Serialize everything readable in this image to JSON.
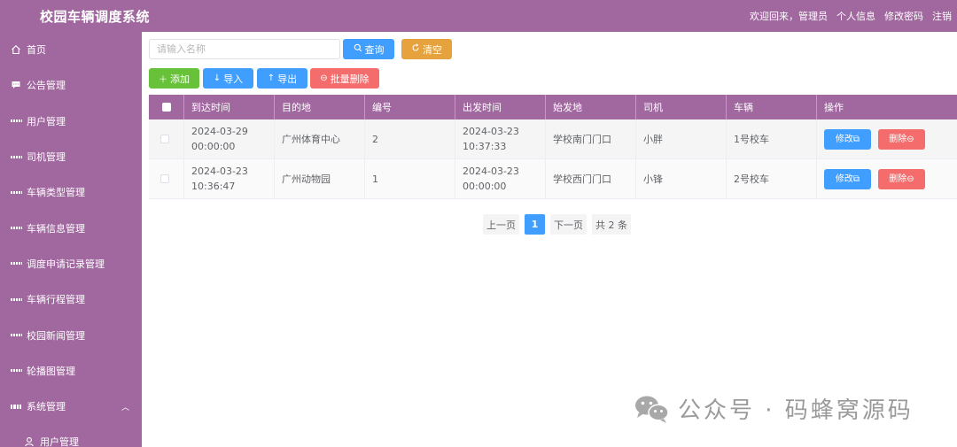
{
  "header": {
    "title": "校园车辆调度系统",
    "welcome": "欢迎回来，管理员",
    "profile": "个人信息",
    "change_password": "修改密码",
    "logout": "注销"
  },
  "sidebar": {
    "items": [
      {
        "label": "首页",
        "icon": "home-icon"
      },
      {
        "label": "公告管理",
        "icon": "chat-icon"
      },
      {
        "label": "用户管理",
        "icon": "grid-icon"
      },
      {
        "label": "司机管理",
        "icon": "grid-icon"
      },
      {
        "label": "车辆类型管理",
        "icon": "grid-icon"
      },
      {
        "label": "车辆信息管理",
        "icon": "grid-icon"
      },
      {
        "label": "调度申请记录管理",
        "icon": "grid-icon"
      },
      {
        "label": "车辆行程管理",
        "icon": "grid-icon"
      },
      {
        "label": "校园新闻管理",
        "icon": "grid-icon"
      },
      {
        "label": "轮播图管理",
        "icon": "grid-icon"
      },
      {
        "label": "系统管理",
        "icon": "apps-icon"
      }
    ],
    "sub_items": [
      {
        "label": "用户管理",
        "icon": "user-icon"
      }
    ]
  },
  "toolbar": {
    "search_placeholder": "请输入名称",
    "search_label": "查询",
    "clear_label": "清空",
    "add_label": "添加",
    "import_label": "导入",
    "export_label": "导出",
    "batch_delete_label": "批量删除"
  },
  "table": {
    "columns": [
      "到达时间",
      "目的地",
      "编号",
      "出发时间",
      "始发地",
      "司机",
      "车辆",
      "操作"
    ],
    "rows": [
      {
        "arrival": "2024-03-29 00:00:00",
        "destination": "广州体育中心",
        "number": "2",
        "departure": "2024-03-23 10:37:33",
        "origin": "学校南门门口",
        "driver": "小胖",
        "vehicle": "1号校车"
      },
      {
        "arrival": "2024-03-23 10:36:47",
        "destination": "广州动物园",
        "number": "1",
        "departure": "2024-03-23 00:00:00",
        "origin": "学校西门门口",
        "driver": "小锋",
        "vehicle": "2号校车"
      }
    ],
    "edit_label": "修改",
    "delete_label": "删除"
  },
  "pagination": {
    "prev": "上一页",
    "current": "1",
    "next": "下一页",
    "total": "共 2 条"
  },
  "watermark": {
    "text": "公众号 · 码蜂窝源码"
  },
  "colors": {
    "theme": "#a0689f",
    "primary": "#409eff",
    "success": "#67c23a",
    "warning": "#e6a23c",
    "danger": "#f56c6c"
  }
}
